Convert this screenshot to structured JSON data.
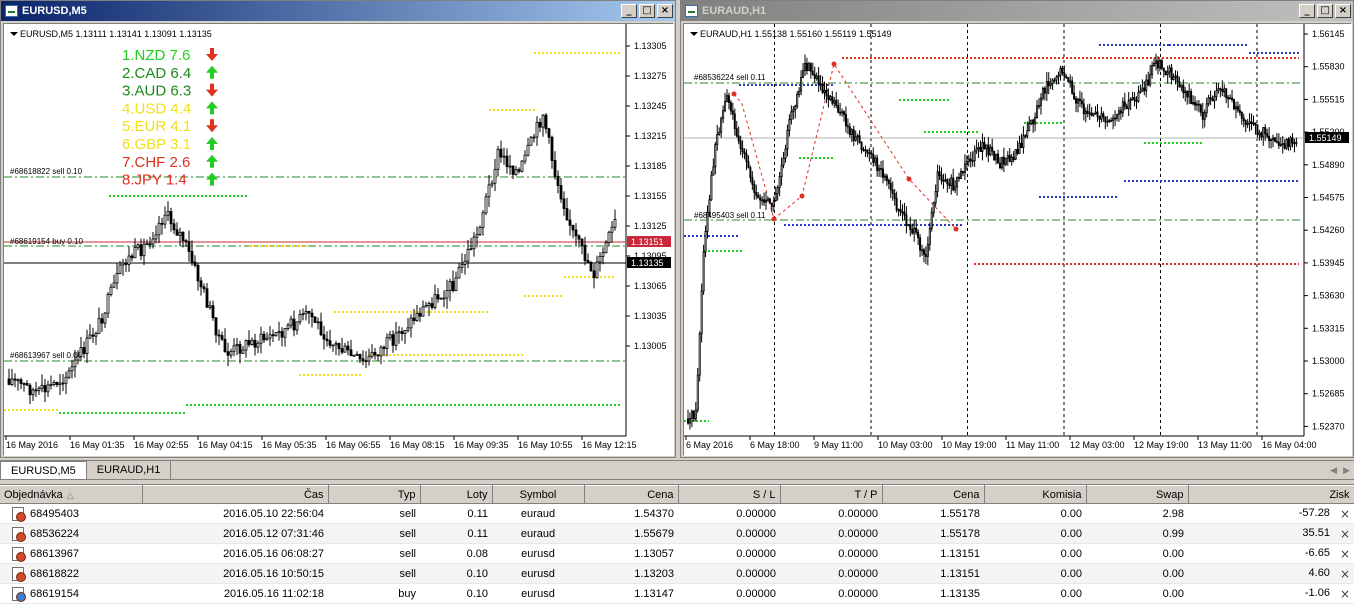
{
  "left_window": {
    "title": "EURUSD,M5",
    "header": "EURUSD,M5  1.13111 1.13141 1.13091 1.13135",
    "price_ticks": [
      "1.13305",
      "1.13275",
      "1.13245",
      "1.13215",
      "1.13185",
      "1.13155",
      "1.13125",
      "1.13095",
      "1.13065",
      "1.13035",
      "1.13005"
    ],
    "time_ticks": [
      "16 May 2016",
      "16 May 01:35",
      "16 May 02:55",
      "16 May 04:15",
      "16 May 05:35",
      "16 May 06:55",
      "16 May 08:15",
      "16 May 09:35",
      "16 May 10:55",
      "16 May 12:15"
    ],
    "order_labels": [
      "#68618822 sell 0.10",
      "#68619154 buy 0.10",
      "#68613967 sell 0.08"
    ],
    "current_bid": "1.13135",
    "ask_marker": "1.13151",
    "ranking": [
      {
        "text": "1.NZD  7.6",
        "color": "#22cc22",
        "dir": "down"
      },
      {
        "text": "2.CAD  6.4",
        "color": "#1a8a1a",
        "dir": "up"
      },
      {
        "text": "3.AUD  6.3",
        "color": "#1a8a1a",
        "dir": "down"
      },
      {
        "text": "4.USD  4.4",
        "color": "#f2e01a",
        "dir": "up"
      },
      {
        "text": "5.EUR  4.1",
        "color": "#f2e01a",
        "dir": "down"
      },
      {
        "text": "6.GBP  3.1",
        "color": "#f2e01a",
        "dir": "up"
      },
      {
        "text": "7.CHF  2.6",
        "color": "#e0301e",
        "dir": "up"
      },
      {
        "text": "8.JPY  1.4",
        "color": "#e0301e",
        "dir": "up"
      }
    ],
    "bull_color": "#1a1a1a",
    "bear_color": "#1a1a1a"
  },
  "right_window": {
    "title": "EURAUD,H1",
    "header": "EURAUD,H1  1.55138 1.55160 1.55119 1.55149",
    "price_ticks": [
      "1.56145",
      "1.55830",
      "1.55515",
      "1.55200",
      "1.54890",
      "1.54575",
      "1.54260",
      "1.53945",
      "1.53630",
      "1.53315",
      "1.53000",
      "1.52685",
      "1.52370"
    ],
    "time_ticks": [
      "6 May 2016",
      "6 May 18:00",
      "9 May 11:00",
      "10 May 03:00",
      "10 May 19:00",
      "11 May 11:00",
      "12 May 03:00",
      "12 May 19:00",
      "13 May 11:00",
      "16 May 04:00"
    ],
    "order_labels": [
      "#68536224 sell 0.11",
      "#68495403 sell 0.11"
    ],
    "current_bid": "1.55149"
  },
  "tabs": [
    {
      "label": "EURUSD,M5",
      "active": true
    },
    {
      "label": "EURAUD,H1",
      "active": false
    }
  ],
  "table": {
    "columns": [
      "Objednávka",
      "Čas",
      "Typ",
      "Loty",
      "Symbol",
      "Cena",
      "S / L",
      "T / P",
      "Cena",
      "Komisia",
      "Swap",
      "Zisk"
    ],
    "rows": [
      {
        "order": "68495403",
        "time": "2016.05.10 22:56:04",
        "type": "sell",
        "lots": "0.11",
        "symbol": "euraud",
        "open": "1.54370",
        "sl": "0.00000",
        "tp": "0.00000",
        "price": "1.55178",
        "commission": "0.00",
        "swap": "2.98",
        "profit": "-57.28"
      },
      {
        "order": "68536224",
        "time": "2016.05.12 07:31:46",
        "type": "sell",
        "lots": "0.11",
        "symbol": "euraud",
        "open": "1.55679",
        "sl": "0.00000",
        "tp": "0.00000",
        "price": "1.55178",
        "commission": "0.00",
        "swap": "0.99",
        "profit": "35.51"
      },
      {
        "order": "68613967",
        "time": "2016.05.16 06:08:27",
        "type": "sell",
        "lots": "0.08",
        "symbol": "eurusd",
        "open": "1.13057",
        "sl": "0.00000",
        "tp": "0.00000",
        "price": "1.13151",
        "commission": "0.00",
        "swap": "0.00",
        "profit": "-6.65"
      },
      {
        "order": "68618822",
        "time": "2016.05.16 10:50:15",
        "type": "sell",
        "lots": "0.10",
        "symbol": "eurusd",
        "open": "1.13203",
        "sl": "0.00000",
        "tp": "0.00000",
        "price": "1.13151",
        "commission": "0.00",
        "swap": "0.00",
        "profit": "4.60"
      },
      {
        "order": "68619154",
        "time": "2016.05.16 11:02:18",
        "type": "buy",
        "lots": "0.10",
        "symbol": "eurusd",
        "open": "1.13147",
        "sl": "0.00000",
        "tp": "0.00000",
        "price": "1.13135",
        "commission": "0.00",
        "swap": "0.00",
        "profit": "-1.06"
      }
    ]
  },
  "close_glyph": "×",
  "minimize_glyph": "_",
  "maximize_glyph": "□",
  "window_close_glyph": "×"
}
